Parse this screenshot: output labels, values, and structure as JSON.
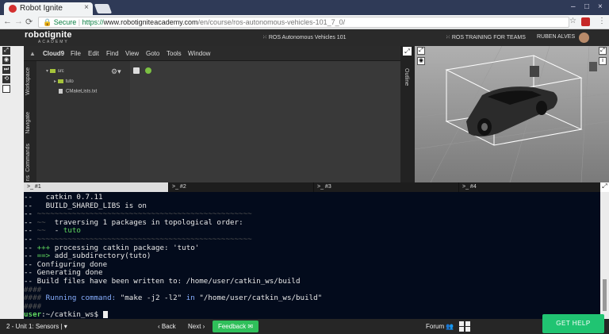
{
  "browser": {
    "tab_title": "Robot Ignite",
    "tab_close": "×",
    "window_controls": [
      "–",
      "□",
      "×"
    ],
    "nav": {
      "back": "←",
      "forward": "→",
      "reload": "⟳"
    },
    "secure_label": "Secure",
    "url_scheme": "https://",
    "url_host": "www.robotigniteacademy.com",
    "url_path": "/en/course/ros-autonomous-vehicles-101_7_0/",
    "star": "☆",
    "menu": "⋮"
  },
  "header": {
    "logo": "robotignite",
    "logo_sub": "ACADEMY",
    "course_title": "ROS Autonomous Vehicles 101",
    "training_link": "ROS TRAINING FOR TEAMS",
    "user_name": "RUBEN ALVES"
  },
  "ide": {
    "menu": [
      "Cloud9",
      "File",
      "Edit",
      "Find",
      "View",
      "Goto",
      "Tools",
      "Window"
    ],
    "side_tabs": [
      "Workspace",
      "Navigate",
      "Commands"
    ],
    "side_tab_cut": "ns",
    "outline_tab": "Outline",
    "tree": [
      {
        "label": "src",
        "kind": "folder"
      },
      {
        "label": "tuto",
        "kind": "folder"
      },
      {
        "label": "CMakeLists.txt",
        "kind": "file"
      }
    ]
  },
  "terminal_tabs": [
    ">_ #1",
    ">_ #2",
    ">_ #3",
    ">_ #4"
  ],
  "terminal_lines": [
    {
      "segs": [
        [
          "",
          "--   catkin 0.7.11"
        ]
      ]
    },
    {
      "segs": [
        [
          "",
          "--   BUILD_SHARED_LIBS is on"
        ]
      ]
    },
    {
      "segs": [
        [
          "",
          "-- "
        ],
        [
          "dim",
          "~~~~~~~~~~~~~~~~~~~~~~~~~~~~~~~~~~~~~~~~~~~~~~~~~"
        ]
      ]
    },
    {
      "segs": [
        [
          "",
          "-- "
        ],
        [
          "dim",
          "~~"
        ],
        [
          "",
          "  traversing 1 packages in topological order:"
        ]
      ]
    },
    {
      "segs": [
        [
          "",
          "-- "
        ],
        [
          "dim",
          "~~"
        ],
        [
          "",
          "  - "
        ],
        [
          "grn",
          "tuto"
        ]
      ]
    },
    {
      "segs": [
        [
          "",
          "-- "
        ],
        [
          "dim",
          "~~~~~~~~~~~~~~~~~~~~~~~~~~~~~~~~~~~~~~~~~~~~~~~~~"
        ]
      ]
    },
    {
      "segs": [
        [
          "",
          "-- "
        ],
        [
          "grn",
          "+++"
        ],
        [
          "",
          " processing catkin package: 'tuto'"
        ]
      ]
    },
    {
      "segs": [
        [
          "",
          "-- "
        ],
        [
          "grn",
          "==>"
        ],
        [
          "",
          " add_subdirectory(tuto)"
        ]
      ]
    },
    {
      "segs": [
        [
          "",
          "-- Configuring done"
        ]
      ]
    },
    {
      "segs": [
        [
          "",
          "-- Generating done"
        ]
      ]
    },
    {
      "segs": [
        [
          "",
          "-- Build files have been written to: /home/user/catkin_ws/build"
        ]
      ]
    },
    {
      "segs": [
        [
          "dim",
          "####"
        ]
      ]
    },
    {
      "segs": [
        [
          "dim",
          "####"
        ],
        [
          "blu",
          " Running command: "
        ],
        [
          "",
          "\"make -j2 -l2\""
        ],
        [
          "blu",
          " in "
        ],
        [
          "",
          "\"/home/user/catkin_ws/build\""
        ]
      ]
    },
    {
      "segs": [
        [
          "dim",
          "####"
        ]
      ]
    },
    {
      "segs": [
        [
          "prm",
          "user"
        ],
        [
          "",
          ":~/catkin_ws$ "
        ]
      ],
      "cursor": true
    }
  ],
  "bottom": {
    "unit": "2 - Unit 1: Sensors |",
    "unit_caret": "▾",
    "back": "‹ Back",
    "next": "Next ›",
    "feedback": "Feedback",
    "forum": "Forum",
    "get_help": "GET HELP"
  }
}
